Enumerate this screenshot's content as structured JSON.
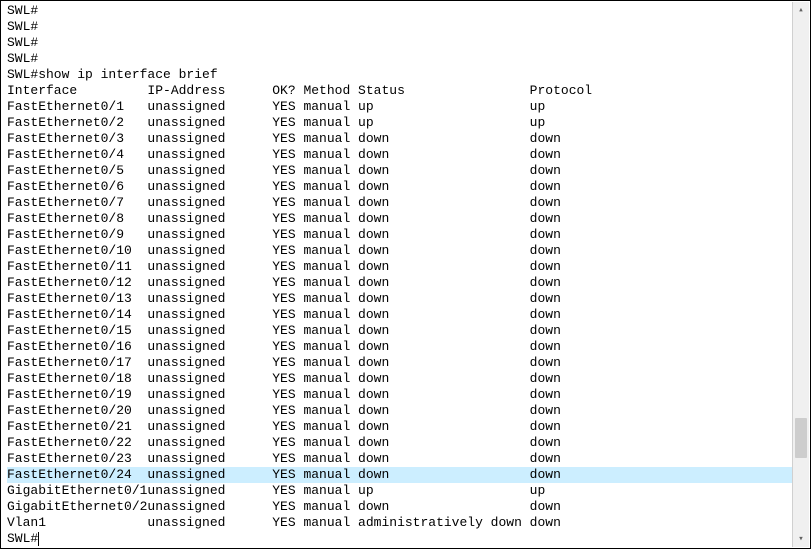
{
  "prompt": "SWL#",
  "pre_prompt_lines": [
    "SWL#",
    "SWL#",
    "SWL#",
    "SWL#"
  ],
  "command": "show ip interface brief",
  "cols": {
    "interface": 18,
    "ip": 16,
    "ok": 4,
    "method": 7,
    "status": 22
  },
  "headers": {
    "interface": "Interface",
    "ip": "IP-Address",
    "ok": "OK?",
    "method": "Method",
    "status": "Status",
    "protocol": "Protocol"
  },
  "rows": [
    {
      "interface": "FastEthernet0/1",
      "ip": "unassigned",
      "ok": "YES",
      "method": "manual",
      "status": "up",
      "protocol": "up",
      "highlight": false
    },
    {
      "interface": "FastEthernet0/2",
      "ip": "unassigned",
      "ok": "YES",
      "method": "manual",
      "status": "up",
      "protocol": "up",
      "highlight": false
    },
    {
      "interface": "FastEthernet0/3",
      "ip": "unassigned",
      "ok": "YES",
      "method": "manual",
      "status": "down",
      "protocol": "down",
      "highlight": false
    },
    {
      "interface": "FastEthernet0/4",
      "ip": "unassigned",
      "ok": "YES",
      "method": "manual",
      "status": "down",
      "protocol": "down",
      "highlight": false
    },
    {
      "interface": "FastEthernet0/5",
      "ip": "unassigned",
      "ok": "YES",
      "method": "manual",
      "status": "down",
      "protocol": "down",
      "highlight": false
    },
    {
      "interface": "FastEthernet0/6",
      "ip": "unassigned",
      "ok": "YES",
      "method": "manual",
      "status": "down",
      "protocol": "down",
      "highlight": false
    },
    {
      "interface": "FastEthernet0/7",
      "ip": "unassigned",
      "ok": "YES",
      "method": "manual",
      "status": "down",
      "protocol": "down",
      "highlight": false
    },
    {
      "interface": "FastEthernet0/8",
      "ip": "unassigned",
      "ok": "YES",
      "method": "manual",
      "status": "down",
      "protocol": "down",
      "highlight": false
    },
    {
      "interface": "FastEthernet0/9",
      "ip": "unassigned",
      "ok": "YES",
      "method": "manual",
      "status": "down",
      "protocol": "down",
      "highlight": false
    },
    {
      "interface": "FastEthernet0/10",
      "ip": "unassigned",
      "ok": "YES",
      "method": "manual",
      "status": "down",
      "protocol": "down",
      "highlight": false
    },
    {
      "interface": "FastEthernet0/11",
      "ip": "unassigned",
      "ok": "YES",
      "method": "manual",
      "status": "down",
      "protocol": "down",
      "highlight": false
    },
    {
      "interface": "FastEthernet0/12",
      "ip": "unassigned",
      "ok": "YES",
      "method": "manual",
      "status": "down",
      "protocol": "down",
      "highlight": false
    },
    {
      "interface": "FastEthernet0/13",
      "ip": "unassigned",
      "ok": "YES",
      "method": "manual",
      "status": "down",
      "protocol": "down",
      "highlight": false
    },
    {
      "interface": "FastEthernet0/14",
      "ip": "unassigned",
      "ok": "YES",
      "method": "manual",
      "status": "down",
      "protocol": "down",
      "highlight": false
    },
    {
      "interface": "FastEthernet0/15",
      "ip": "unassigned",
      "ok": "YES",
      "method": "manual",
      "status": "down",
      "protocol": "down",
      "highlight": false
    },
    {
      "interface": "FastEthernet0/16",
      "ip": "unassigned",
      "ok": "YES",
      "method": "manual",
      "status": "down",
      "protocol": "down",
      "highlight": false
    },
    {
      "interface": "FastEthernet0/17",
      "ip": "unassigned",
      "ok": "YES",
      "method": "manual",
      "status": "down",
      "protocol": "down",
      "highlight": false
    },
    {
      "interface": "FastEthernet0/18",
      "ip": "unassigned",
      "ok": "YES",
      "method": "manual",
      "status": "down",
      "protocol": "down",
      "highlight": false
    },
    {
      "interface": "FastEthernet0/19",
      "ip": "unassigned",
      "ok": "YES",
      "method": "manual",
      "status": "down",
      "protocol": "down",
      "highlight": false
    },
    {
      "interface": "FastEthernet0/20",
      "ip": "unassigned",
      "ok": "YES",
      "method": "manual",
      "status": "down",
      "protocol": "down",
      "highlight": false
    },
    {
      "interface": "FastEthernet0/21",
      "ip": "unassigned",
      "ok": "YES",
      "method": "manual",
      "status": "down",
      "protocol": "down",
      "highlight": false
    },
    {
      "interface": "FastEthernet0/22",
      "ip": "unassigned",
      "ok": "YES",
      "method": "manual",
      "status": "down",
      "protocol": "down",
      "highlight": false
    },
    {
      "interface": "FastEthernet0/23",
      "ip": "unassigned",
      "ok": "YES",
      "method": "manual",
      "status": "down",
      "protocol": "down",
      "highlight": false
    },
    {
      "interface": "FastEthernet0/24",
      "ip": "unassigned",
      "ok": "YES",
      "method": "manual",
      "status": "down",
      "protocol": "down",
      "highlight": true
    },
    {
      "interface": "GigabitEthernet0/1",
      "ip": "unassigned",
      "ok": "YES",
      "method": "manual",
      "status": "up",
      "protocol": "up",
      "highlight": false
    },
    {
      "interface": "GigabitEthernet0/2",
      "ip": "unassigned",
      "ok": "YES",
      "method": "manual",
      "status": "down",
      "protocol": "down",
      "highlight": false
    },
    {
      "interface": "Vlan1",
      "ip": "unassigned",
      "ok": "YES",
      "method": "manual",
      "status": "administratively down",
      "protocol": "down",
      "highlight": false
    }
  ],
  "scrollbar": {
    "up_glyph": "▴",
    "down_glyph": "▾"
  }
}
